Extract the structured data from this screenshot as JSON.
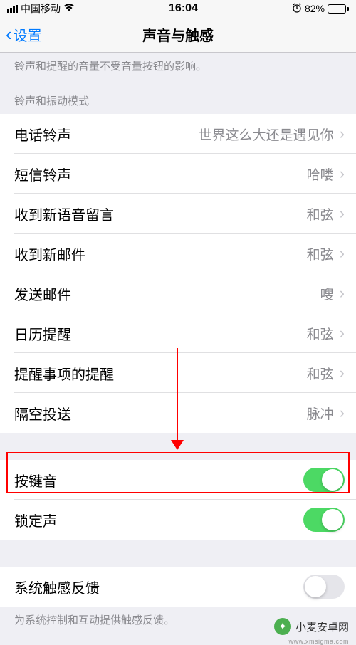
{
  "status": {
    "carrier": "中国移动",
    "time": "16:04",
    "battery_pct": "82%"
  },
  "nav": {
    "back": "设置",
    "title": "声音与触感"
  },
  "note": "铃声和提醒的音量不受音量按钮的影响。",
  "section_header": "铃声和振动模式",
  "rows": [
    {
      "label": "电话铃声",
      "value": "世界这么大还是遇见你"
    },
    {
      "label": "短信铃声",
      "value": "哈喽"
    },
    {
      "label": "收到新语音留言",
      "value": "和弦"
    },
    {
      "label": "收到新邮件",
      "value": "和弦"
    },
    {
      "label": "发送邮件",
      "value": "嗖"
    },
    {
      "label": "日历提醒",
      "value": "和弦"
    },
    {
      "label": "提醒事项的提醒",
      "value": "和弦"
    },
    {
      "label": "隔空投送",
      "value": "脉冲"
    }
  ],
  "toggles": [
    {
      "label": "按键音",
      "on": true
    },
    {
      "label": "锁定声",
      "on": true
    }
  ],
  "toggles2": [
    {
      "label": "系统触感反馈",
      "on": false
    }
  ],
  "footer": "为系统控制和互动提供触感反馈。",
  "watermark": {
    "text": "小麦安卓网",
    "url": "www.xmsigma.com"
  }
}
